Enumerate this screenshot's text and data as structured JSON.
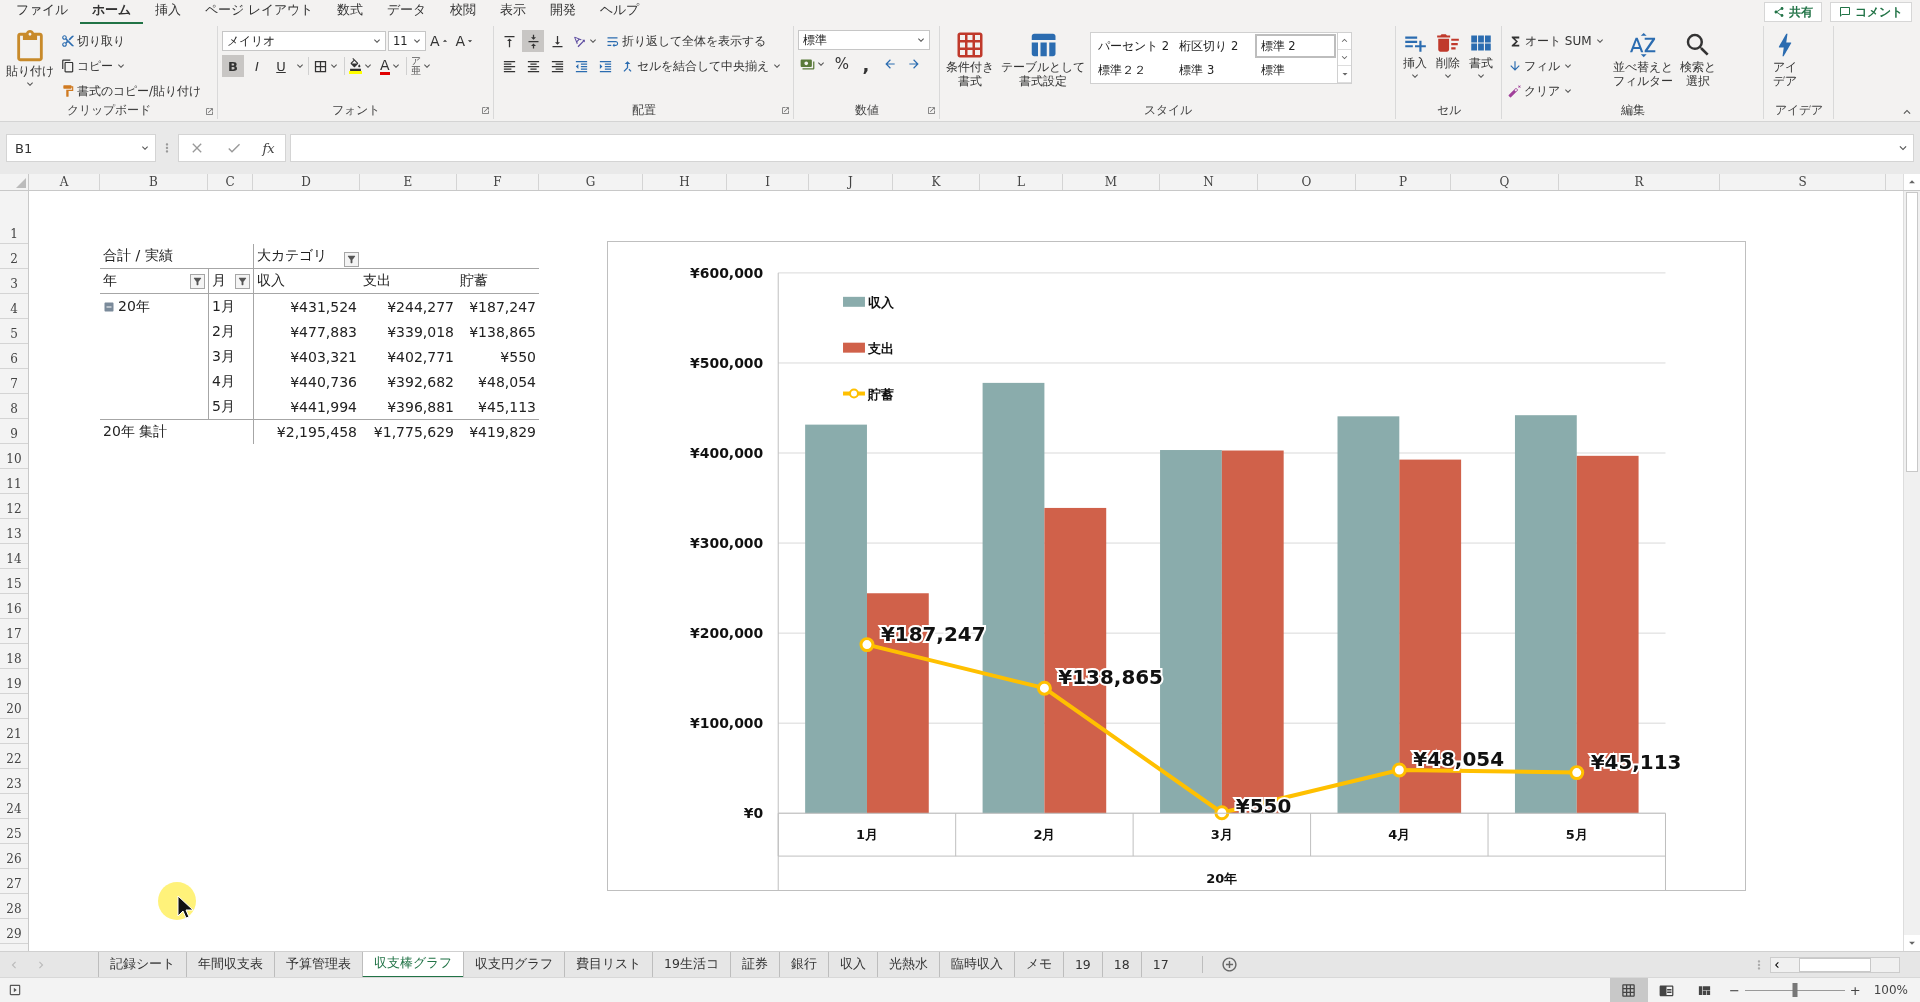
{
  "menu_tabs": [
    {
      "label": "ファイル",
      "selected": false
    },
    {
      "label": "ホーム",
      "selected": true
    },
    {
      "label": "挿入",
      "selected": false
    },
    {
      "label": "ページ レイアウト",
      "selected": false
    },
    {
      "label": "数式",
      "selected": false
    },
    {
      "label": "データ",
      "selected": false
    },
    {
      "label": "校閲",
      "selected": false
    },
    {
      "label": "表示",
      "selected": false
    },
    {
      "label": "開発",
      "selected": false
    },
    {
      "label": "ヘルプ",
      "selected": false
    }
  ],
  "share_button": "共有",
  "comment_button": "コメント",
  "ribbon": {
    "clipboard": {
      "label": "クリップボード",
      "paste": "貼り付け",
      "cut": "切り取り",
      "copy": "コピー",
      "format_painter": "書式のコピー/貼り付け"
    },
    "font": {
      "label": "フォント",
      "font_name": "メイリオ",
      "font_size": "11",
      "grow": "A",
      "shrink": "A",
      "bold": {
        "text": "B",
        "on": true
      },
      "italic": "I",
      "underline": "U",
      "font_color": "A",
      "phonetic_top": "ア",
      "phonetic_bottom": "亜"
    },
    "alignment": {
      "label": "配置",
      "vertical": [
        {
          "kind": "top",
          "on": false
        },
        {
          "kind": "middle",
          "on": true
        },
        {
          "kind": "bottom",
          "on": false
        }
      ],
      "wrap_text": "折り返して全体を表示する",
      "merge_center": "セルを結合して中央揃え"
    },
    "number": {
      "label": "数値",
      "format": "標準",
      "percent": "%",
      "comma": ","
    },
    "styles": {
      "label": "スタイル",
      "conditional": [
        "条件付き",
        "書式"
      ],
      "table": [
        "テーブルとして",
        "書式設定"
      ],
      "gallery": [
        {
          "label": "パーセント 2",
          "selected": false
        },
        {
          "label": "桁区切り 2",
          "selected": false
        },
        {
          "label": "標準 2",
          "selected": true
        },
        {
          "label": "標準２２",
          "selected": false
        },
        {
          "label": "標準 3",
          "selected": false
        },
        {
          "label": "標準",
          "selected": false
        }
      ]
    },
    "cells": {
      "label": "セル",
      "insert": "挿入",
      "delete": "削除",
      "format": "書式"
    },
    "editing": {
      "label": "編集",
      "autosum": "オート SUM",
      "fill": "フィル",
      "clear": "クリア",
      "sort": [
        "並べ替えと",
        "フィルター"
      ],
      "find": [
        "検索と",
        "選択"
      ]
    },
    "ideas": {
      "label": "アイデア",
      "button": [
        "アイ",
        "デア"
      ]
    }
  },
  "formula_bar": {
    "name_box": "B1",
    "fx": "fx"
  },
  "columns": [
    "A",
    "B",
    "C",
    "D",
    "E",
    "F",
    "G",
    "H",
    "I",
    "J",
    "K",
    "L",
    "M",
    "N",
    "O",
    "P",
    "Q",
    "R",
    "S"
  ],
  "rows": [
    "1",
    "2",
    "3",
    "4",
    "5",
    "6",
    "7",
    "8",
    "9",
    "10",
    "11",
    "12",
    "13",
    "14",
    "15",
    "16",
    "17",
    "18",
    "19",
    "20",
    "21",
    "22",
    "23",
    "24",
    "25",
    "26",
    "27",
    "28",
    "29"
  ],
  "pivot": {
    "value_label": "合計 / 実績",
    "column_field": "大カテゴリ",
    "row_fields": [
      "年",
      "月"
    ],
    "value_headers": [
      "収入",
      "支出",
      "貯蓄"
    ],
    "year": "20年",
    "rows": [
      {
        "month": "1月",
        "values": [
          "¥431,524",
          "¥244,277",
          "¥187,247"
        ]
      },
      {
        "month": "2月",
        "values": [
          "¥477,883",
          "¥339,018",
          "¥138,865"
        ]
      },
      {
        "month": "3月",
        "values": [
          "¥403,321",
          "¥402,771",
          "¥550"
        ]
      },
      {
        "month": "4月",
        "values": [
          "¥440,736",
          "¥392,682",
          "¥48,054"
        ]
      },
      {
        "month": "5月",
        "values": [
          "¥441,994",
          "¥396,881",
          "¥45,113"
        ]
      }
    ],
    "total_label": "20年 集計",
    "totals": [
      "¥2,195,458",
      "¥1,775,629",
      "¥419,829"
    ]
  },
  "chart": {
    "chart_data": {
      "type": "bar",
      "categories": [
        "1月",
        "2月",
        "3月",
        "4月",
        "5月"
      ],
      "xlabel": "20年",
      "series": [
        {
          "name": "収入",
          "type": "bar",
          "color": "#8aacac",
          "values": [
            431524,
            477883,
            403321,
            440736,
            441994
          ]
        },
        {
          "name": "支出",
          "type": "bar",
          "color": "#d0614a",
          "values": [
            244277,
            339018,
            402771,
            392682,
            396881
          ]
        },
        {
          "name": "貯蓄",
          "type": "line",
          "color": "#ffc000",
          "marker": "circle",
          "values": [
            187247,
            138865,
            550,
            48054,
            45113
          ],
          "value_labels": [
            "¥187,247",
            "¥138,865",
            "¥550",
            "¥48,054",
            "¥45,113"
          ]
        }
      ],
      "grid": true,
      "legend": true,
      "ylim": [
        0,
        600000
      ],
      "yticks": [
        {
          "value": 0,
          "label": "¥0"
        },
        {
          "value": 100000,
          "label": "¥100,000"
        },
        {
          "value": 200000,
          "label": "¥200,000"
        },
        {
          "value": 300000,
          "label": "¥300,000"
        },
        {
          "value": 400000,
          "label": "¥400,000"
        },
        {
          "value": 500000,
          "label": "¥500,000"
        },
        {
          "value": 600000,
          "label": "¥600,000"
        }
      ]
    }
  },
  "sheet_tabs": [
    {
      "label": "記録シート",
      "selected": false
    },
    {
      "label": "年間収支表",
      "selected": false
    },
    {
      "label": "予算管理表",
      "selected": false
    },
    {
      "label": "収支棒グラフ",
      "selected": true
    },
    {
      "label": "収支円グラフ",
      "selected": false
    },
    {
      "label": "費目リスト",
      "selected": false
    },
    {
      "label": "19生活コ",
      "selected": false
    },
    {
      "label": "証券",
      "selected": false
    },
    {
      "label": "銀行",
      "selected": false
    },
    {
      "label": "収入",
      "selected": false
    },
    {
      "label": "光熱水",
      "selected": false
    },
    {
      "label": "臨時収入",
      "selected": false
    },
    {
      "label": "メモ",
      "selected": false
    },
    {
      "label": "19",
      "selected": false
    },
    {
      "label": "18",
      "selected": false
    },
    {
      "label": "17",
      "selected": false
    }
  ],
  "status_bar": {
    "views": [
      {
        "kind": "normal",
        "selected": true
      },
      {
        "kind": "page_layout",
        "selected": false
      },
      {
        "kind": "page_break",
        "selected": false
      }
    ],
    "zoom": {
      "minus": "−",
      "plus": "+",
      "level": 0.5,
      "reading": "100%"
    }
  }
}
